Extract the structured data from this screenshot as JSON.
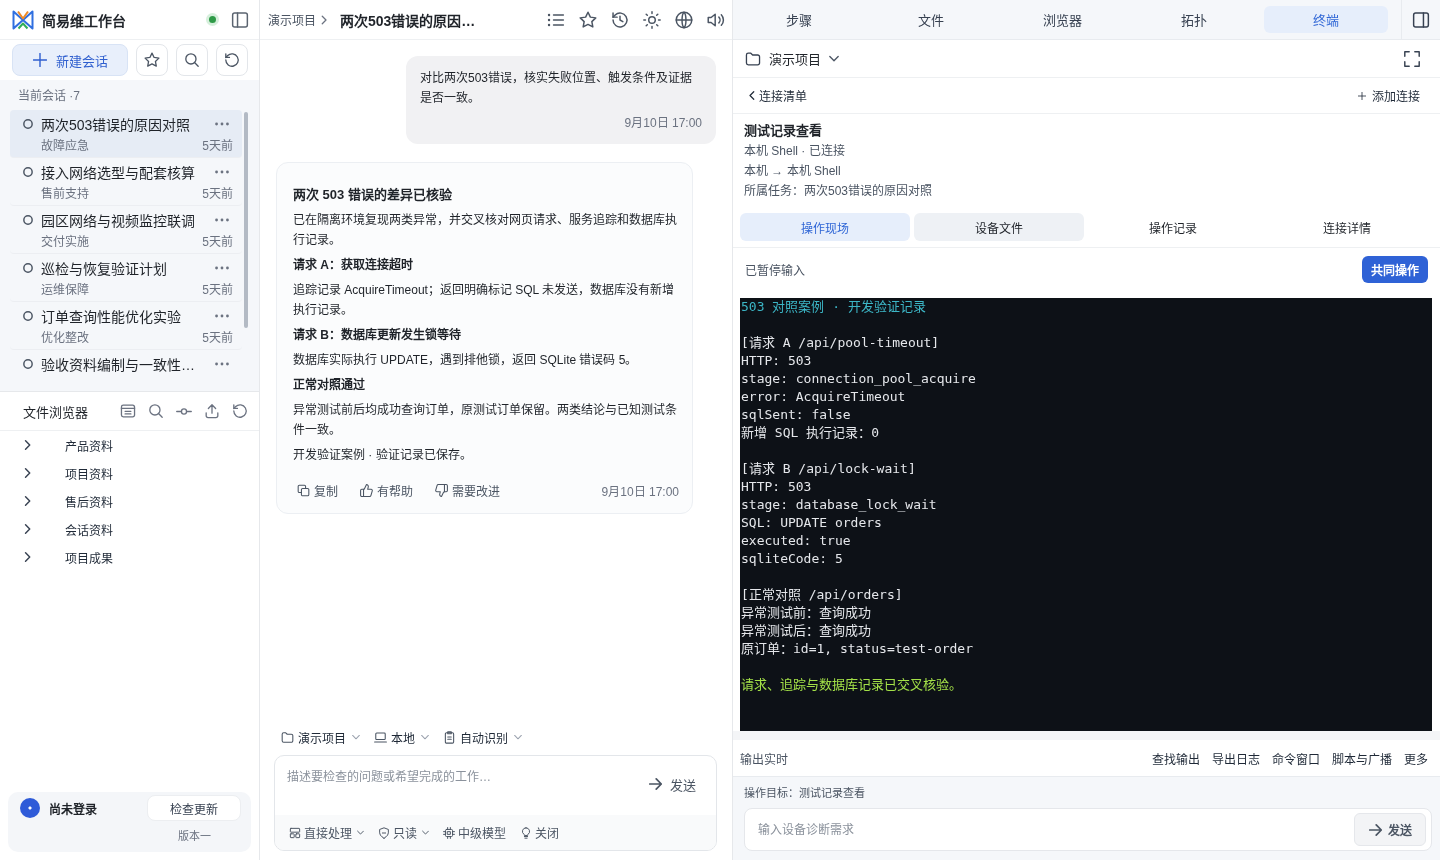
{
  "sidebar": {
    "app_title": "简易维工作台",
    "online": true,
    "new_chat_button": "新建会话",
    "sessions_heading": "当前会话 ·7",
    "sessions": [
      {
        "title": "两次503错误的原因对照",
        "category": "故障应急",
        "time": "5天前",
        "selected": true
      },
      {
        "title": "接入网络选型与配套核算",
        "category": "售前支持",
        "time": "5天前",
        "selected": false
      },
      {
        "title": "园区网络与视频监控联调",
        "category": "交付实施",
        "time": "5天前",
        "selected": false
      },
      {
        "title": "巡检与恢复验证计划",
        "category": "运维保障",
        "time": "5天前",
        "selected": false
      },
      {
        "title": "订单查询性能优化实验",
        "category": "优化整改",
        "time": "5天前",
        "selected": false
      },
      {
        "title": "验收资料编制与一致性…",
        "selected": false
      }
    ],
    "file_browser": {
      "title": "文件浏览器",
      "folders": [
        {
          "label": "产品资料",
          "expanded": false
        },
        {
          "label": "项目资料",
          "expanded": false
        },
        {
          "label": "售后资料",
          "expanded": false
        },
        {
          "label": "会话资料",
          "expanded": false
        },
        {
          "label": "项目成果",
          "expanded": false
        }
      ]
    },
    "account": {
      "name": "尚未登录",
      "update_button": "检查更新",
      "version": "版本一"
    }
  },
  "chat": {
    "breadcrumb": "演示项目",
    "title": "两次503错误的原因…",
    "messages": [
      {
        "kind": "user",
        "text": "对比两次503错误，核实失败位置、触发条件及证据是否一致。",
        "time": "9月10日 17:00"
      },
      {
        "kind": "assistant",
        "title": "两次 503 错误的差异已核验",
        "blocks": [
          {
            "kind": "paragraph",
            "text": "已在隔离环境复现两类异常，并交叉核对网页请求、服务追踪和数据库执行记录。"
          },
          {
            "kind": "heading",
            "text": "请求 A：获取连接超时"
          },
          {
            "kind": "paragraph",
            "text": "追踪记录 AcquireTimeout；返回明确标记 SQL 未发送，数据库没有新增执行记录。"
          },
          {
            "kind": "heading",
            "text": "请求 B：数据库更新发生锁等待"
          },
          {
            "kind": "paragraph",
            "text": "数据库实际执行 UPDATE，遇到排他锁，返回 SQLite 错误码 5。"
          },
          {
            "kind": "heading",
            "text": "正常对照通过"
          },
          {
            "kind": "paragraph",
            "text": "异常测试前后均成功查询订单，原测试订单保留。两类结论与已知测试条件一致。"
          },
          {
            "kind": "paragraph",
            "text": "开发验证案例 · 验证记录已保存。"
          }
        ],
        "actions": [
          "复制",
          "有帮助",
          "需要改进"
        ],
        "time": "9月10日 17:00"
      }
    ],
    "context": [
      {
        "label": "演示项目",
        "dropdown": true
      },
      {
        "label": "本地",
        "dropdown": true
      },
      {
        "label": "自动识别",
        "dropdown": true
      }
    ],
    "composer": {
      "placeholder": "描述要检查的问题或希望完成的工作…",
      "send_button": "发送",
      "options": [
        {
          "label": "直接处理",
          "dropdown": true
        },
        {
          "label": "只读",
          "dropdown": true
        },
        {
          "label": "中级模型",
          "dropdown": false
        },
        {
          "label": "关闭",
          "dropdown": false
        }
      ]
    }
  },
  "panel": {
    "tabs": [
      {
        "label": "步骤",
        "selected": false
      },
      {
        "label": "文件",
        "selected": false
      },
      {
        "label": "浏览器",
        "selected": false
      },
      {
        "label": "拓扑",
        "selected": false
      },
      {
        "label": "终端",
        "selected": true
      }
    ],
    "project": "演示项目",
    "back_link": "连接清单",
    "add_link": "添加连接",
    "connection": {
      "title": "测试记录查看",
      "status": "本机 Shell · 已连接",
      "route": "本机 → 本机 Shell",
      "task": "所属任务：两次503错误的原因对照"
    },
    "subtabs": [
      {
        "label": "操作现场",
        "selected": true,
        "hovered": false
      },
      {
        "label": "设备文件",
        "selected": false,
        "hovered": true
      },
      {
        "label": "操作记录",
        "selected": false,
        "hovered": false
      },
      {
        "label": "连接详情",
        "selected": false,
        "hovered": false
      }
    ],
    "input_state": "已暂停输入",
    "share_button": "共同操作",
    "terminal": [
      {
        "kind": "title",
        "lines": [
          "503 对照案例 · 开发验证记录"
        ]
      },
      {
        "kind": "output",
        "lines": [
          "[请求 A /api/pool-timeout]",
          "HTTP: 503",
          "stage: connection_pool_acquire",
          "error: AcquireTimeout",
          "sqlSent: false",
          "新增 SQL 执行记录：0"
        ]
      },
      {
        "kind": "output",
        "lines": [
          "[请求 B /api/lock-wait]",
          "HTTP: 503",
          "stage: database_lock_wait",
          "SQL: UPDATE orders",
          "executed: true",
          "sqliteCode: 5"
        ]
      },
      {
        "kind": "output",
        "lines": [
          "[正常对照 /api/orders]",
          "异常测试前：查询成功",
          "异常测试后：查询成功",
          "原订单：id=1, status=test-order"
        ]
      },
      {
        "kind": "success",
        "lines": [
          "请求、追踪与数据库记录已交叉核验。"
        ]
      }
    ],
    "output_status": "输出实时",
    "output_actions": [
      "查找输出",
      "导出日志",
      "命令窗口",
      "脚本与广播",
      "更多"
    ],
    "target": "操作目标：测试记录查看",
    "input": {
      "placeholder": "输入设备诊断需求",
      "send_button": "发送"
    }
  }
}
